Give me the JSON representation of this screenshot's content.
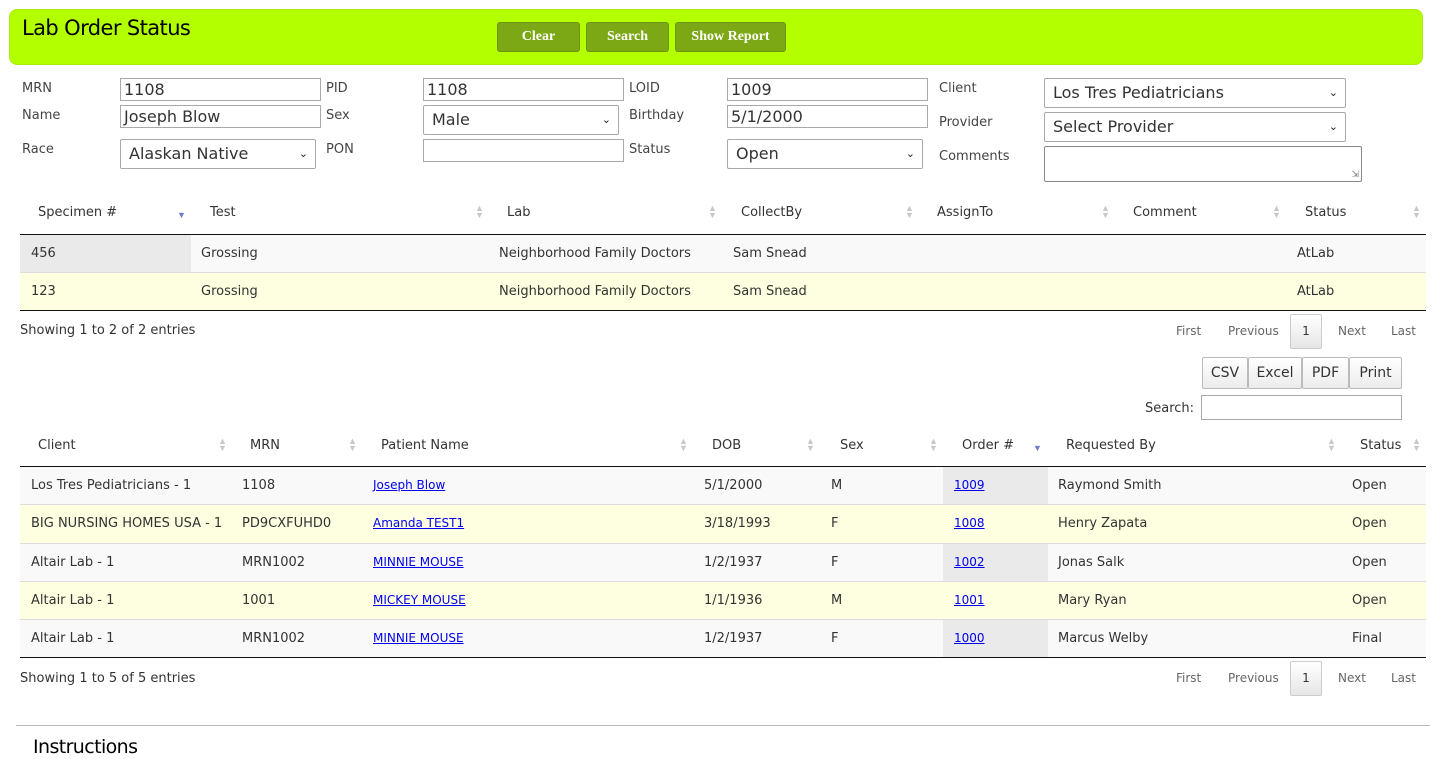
{
  "header": {
    "title": "Lab Order Status",
    "clear": "Clear",
    "search": "Search",
    "show_report": "Show Report"
  },
  "form": {
    "mrn_label": "MRN",
    "mrn_value": "1108",
    "pid_label": "PID",
    "pid_value": "1108",
    "loid_label": "LOID",
    "loid_value": "1009",
    "client_label": "Client",
    "client_value": "Los Tres Pediatricians",
    "name_label": "Name",
    "name_value": "Joseph Blow",
    "sex_label": "Sex",
    "sex_value": "Male",
    "birthday_label": "Birthday",
    "birthday_value": "5/1/2000",
    "provider_label": "Provider",
    "provider_value": "Select Provider",
    "race_label": "Race",
    "race_value": "Alaskan Native",
    "pon_label": "PON",
    "pon_value": "",
    "status_label": "Status",
    "status_value": "Open",
    "comments_label": "Comments",
    "comments_value": ""
  },
  "specimens": {
    "columns": [
      "Specimen #",
      "Test",
      "Lab",
      "CollectBy",
      "AssignTo",
      "Comment",
      "Status"
    ],
    "rows": [
      [
        "456",
        "Grossing",
        "Neighborhood Family Doctors",
        "Sam Snead",
        "",
        "",
        "AtLab"
      ],
      [
        "123",
        "Grossing",
        "Neighborhood Family Doctors",
        "Sam Snead",
        "",
        "",
        "AtLab"
      ]
    ],
    "info": "Showing 1 to 2 of 2 entries",
    "pager": {
      "first": "First",
      "previous": "Previous",
      "current": "1",
      "next": "Next",
      "last": "Last"
    }
  },
  "export": {
    "csv": "CSV",
    "excel": "Excel",
    "pdf": "PDF",
    "print": "Print",
    "search_label": "Search:",
    "search_value": ""
  },
  "orders": {
    "columns": [
      "Client",
      "MRN",
      "Patient Name",
      "DOB",
      "Sex",
      "Order #",
      "Requested By",
      "Status"
    ],
    "rows": [
      [
        "Los Tres Pediatricians - 1",
        "1108",
        "Joseph Blow",
        "5/1/2000",
        "M",
        "1009",
        "Raymond Smith",
        "Open"
      ],
      [
        "BIG NURSING HOMES USA - 1",
        "PD9CXFUHD0",
        "Amanda TEST1",
        "3/18/1993",
        "F",
        "1008",
        "Henry Zapata",
        "Open"
      ],
      [
        "Altair Lab - 1",
        "MRN1002",
        "MINNIE MOUSE",
        "1/2/1937",
        "F",
        "1002",
        "Jonas Salk",
        "Open"
      ],
      [
        "Altair Lab - 1",
        "1001",
        "MICKEY MOUSE",
        "1/1/1936",
        "M",
        "1001",
        "Mary Ryan",
        "Open"
      ],
      [
        "Altair Lab - 1",
        "MRN1002",
        "MINNIE MOUSE",
        "1/2/1937",
        "F",
        "1000",
        "Marcus Welby",
        "Final"
      ]
    ],
    "info": "Showing 1 to 5 of 5 entries",
    "pager": {
      "first": "First",
      "previous": "Previous",
      "current": "1",
      "next": "Next",
      "last": "Last"
    }
  },
  "instructions": "Instructions"
}
